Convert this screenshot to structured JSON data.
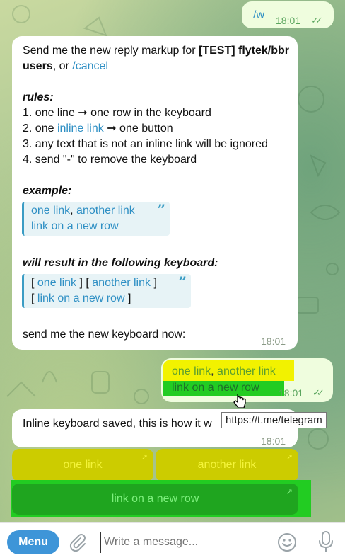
{
  "colors": {
    "accent": "#3e95d8",
    "link": "#2e8fc4",
    "outgoing": "#effdde",
    "highlight_yellow": "#f2f200",
    "highlight_green": "#22cc22"
  },
  "messages": {
    "cmd": {
      "text": "/w",
      "time": "18:01"
    },
    "instructions": {
      "intro_a": "Send me the new reply markup for ",
      "intro_bold": "[TEST] flytek/bbr users",
      "intro_b": ", or ",
      "cancel": "/cancel",
      "rules_title": "rules:",
      "rule1": "1. one line ➞ one row in the keyboard",
      "rule2_a": "2. one ",
      "rule2_link": "inline link",
      "rule2_b": " ➞ one button",
      "rule3": "3. any text that is not an inline link will be ignored",
      "rule4": "4. send \"-\" to remove the keyboard",
      "example_title": "example:",
      "example_l1_a": "one link",
      "example_l1_sep": ", ",
      "example_l1_b": "another link",
      "example_l2": "link on a new row",
      "result_title": "will result in the following keyboard:",
      "kb_l1_open": "[ ",
      "kb_l1_a": "one link",
      "kb_l1_mid": " ] [ ",
      "kb_l1_b": "another link",
      "kb_l1_close": " ]",
      "kb_l2_open": "[ ",
      "kb_l2": "link on a new row",
      "kb_l2_close": " ]",
      "footer": "send me the new keyboard now:",
      "time": "18:01"
    },
    "reply": {
      "l1_a": "one link",
      "l1_sep": ", ",
      "l1_b": "another link",
      "l2": "link on a new row",
      "time": "18:01"
    },
    "saved": {
      "text": "Inline keyboard saved, this is how it w",
      "time": "18:01"
    }
  },
  "tooltip": "https://t.me/telegram",
  "inline_keyboard": {
    "btn1": "one link",
    "btn2": "another link",
    "btn3": "link on a new row"
  },
  "composer": {
    "menu": "Menu",
    "placeholder": "Write a message..."
  },
  "icons": [
    "paperclip-icon",
    "emoji-icon",
    "microphone-icon",
    "double-check-icon",
    "arrow-icon",
    "quote-icon",
    "pointer-cursor-icon"
  ]
}
